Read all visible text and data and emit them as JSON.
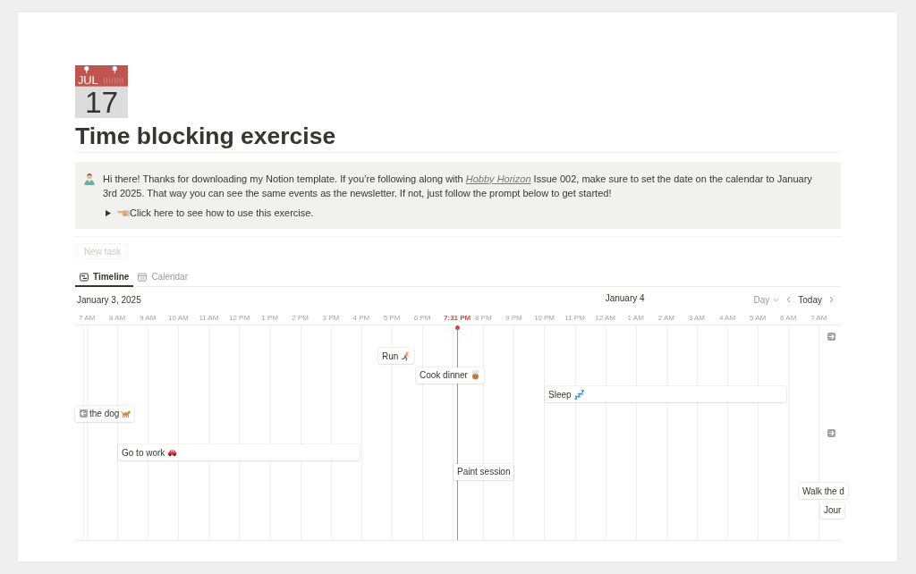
{
  "page": {
    "icon": {
      "month": "JUL",
      "day": "17"
    },
    "title": "Time blocking exercise"
  },
  "callout": {
    "text_before": "Hi there! Thanks for downloading my Notion template. If you’re following along with",
    "link": "Hobby Horizon",
    "text_after": "Issue 002, make sure to set the date on the calendar to January 3rd 2025. That way you can see the same events as the newsletter. If not, just follow the prompt below to get started!",
    "toggle": {
      "expanded": false,
      "text": "Click here to see how to use this exercise."
    }
  },
  "new_task": {
    "label": "New task",
    "disabled": true
  },
  "tabs": [
    {
      "kind": "timeline",
      "label": "Timeline",
      "selected": true
    },
    {
      "kind": "calendar",
      "label": "Calendar",
      "selected": false
    }
  ],
  "timeline": {
    "date": "January 3, 2025",
    "next_date": "January 4",
    "view": "Day",
    "today": "Today",
    "hours": [
      {
        "label": "7 AM",
        "now": false
      },
      {
        "label": "8 AM",
        "now": false
      },
      {
        "label": "9 AM",
        "now": false
      },
      {
        "label": "10 AM",
        "now": false
      },
      {
        "label": "11 AM",
        "now": false
      },
      {
        "label": "12 PM",
        "now": false
      },
      {
        "label": "1 PM",
        "now": false
      },
      {
        "label": "2 PM",
        "now": false
      },
      {
        "label": "3 PM",
        "now": false
      },
      {
        "label": "4 PM",
        "now": false
      },
      {
        "label": "5 PM",
        "now": false
      },
      {
        "label": "6 PM",
        "now": false
      },
      {
        "label": "7:31 PM",
        "now": true
      },
      {
        "label": "8 PM",
        "now": false
      },
      {
        "label": "9 PM",
        "now": false
      },
      {
        "label": "10 PM",
        "now": false
      },
      {
        "label": "11 PM",
        "now": false
      },
      {
        "label": "12 AM",
        "now": false
      },
      {
        "label": "1 AM",
        "now": false
      },
      {
        "label": "2 AM",
        "now": false
      },
      {
        "label": "3 AM",
        "now": false
      },
      {
        "label": "4 AM",
        "now": false
      },
      {
        "label": "5 AM",
        "now": false
      },
      {
        "label": "6 AM",
        "now": false
      },
      {
        "label": "7 AM",
        "now": false
      }
    ],
    "events": [
      {
        "kind": "offscreen_right"
      },
      {
        "kind": "card",
        "title": "Run"
      },
      {
        "kind": "card",
        "title": "Cook dinner"
      },
      {
        "kind": "card",
        "title": "Sleep"
      },
      {
        "kind": "offscreen_left",
        "title": "the dog"
      },
      {
        "kind": "offscreen_right"
      },
      {
        "kind": "card",
        "title": "Go to work"
      },
      {
        "kind": "card",
        "title": "Paint session"
      },
      {
        "kind": "card",
        "title": "Walk the d"
      },
      {
        "kind": "card",
        "title": "Jour"
      }
    ]
  }
}
